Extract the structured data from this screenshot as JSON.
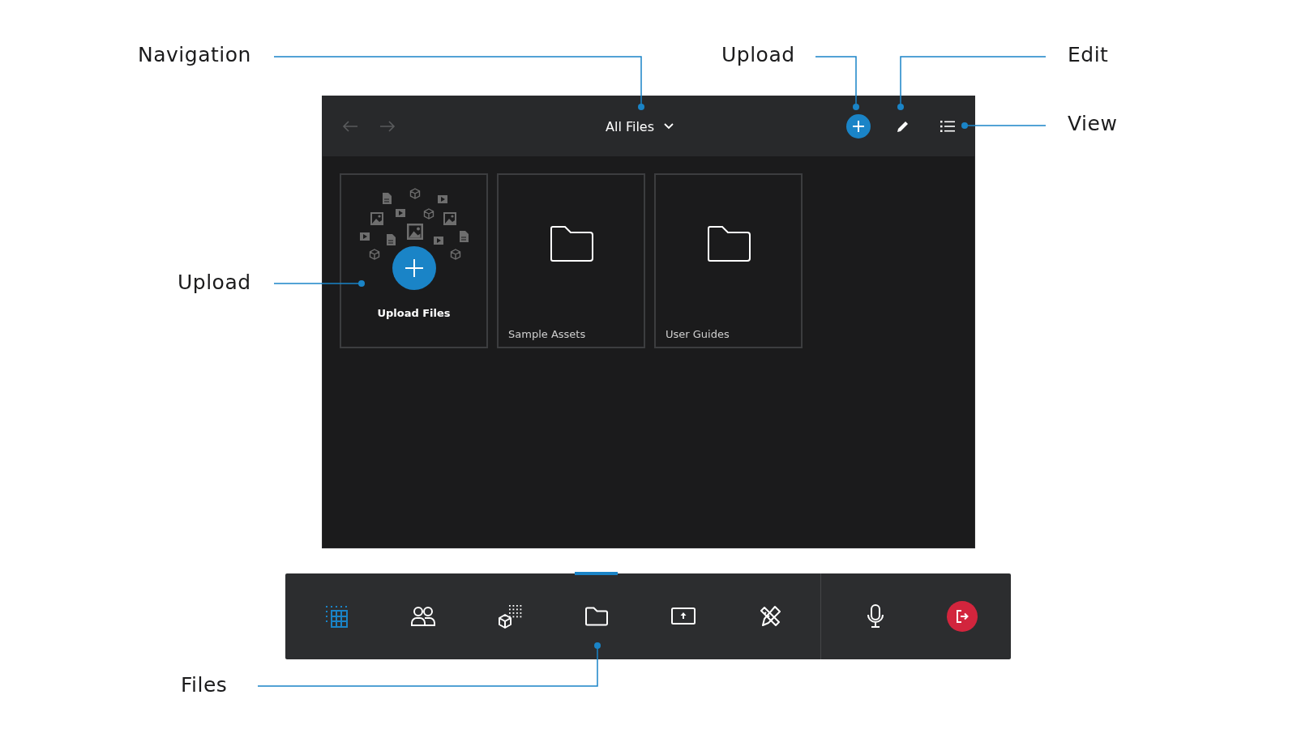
{
  "callouts": [
    {
      "label": "Navigation"
    },
    {
      "label": "Upload"
    },
    {
      "label": "Edit"
    },
    {
      "label": "View"
    },
    {
      "label": "Upload"
    },
    {
      "label": "Files"
    }
  ],
  "header": {
    "back": {
      "disabled": true
    },
    "forward": {
      "disabled": true
    },
    "title": "All Files"
  },
  "cards": [
    {
      "kind": "upload",
      "label": "Upload Files"
    },
    {
      "kind": "folder",
      "label": "Sample Assets"
    },
    {
      "kind": "folder",
      "label": "User Guides"
    }
  ],
  "toolbar": {
    "items": [
      {
        "kind": "grid",
        "selected": false
      },
      {
        "kind": "people",
        "selected": false
      },
      {
        "kind": "objects",
        "selected": false
      },
      {
        "kind": "folder",
        "selected": true
      },
      {
        "kind": "share",
        "selected": false
      },
      {
        "kind": "tools",
        "selected": false
      }
    ],
    "end_items": [
      {
        "kind": "mic"
      },
      {
        "kind": "leave"
      }
    ]
  }
}
